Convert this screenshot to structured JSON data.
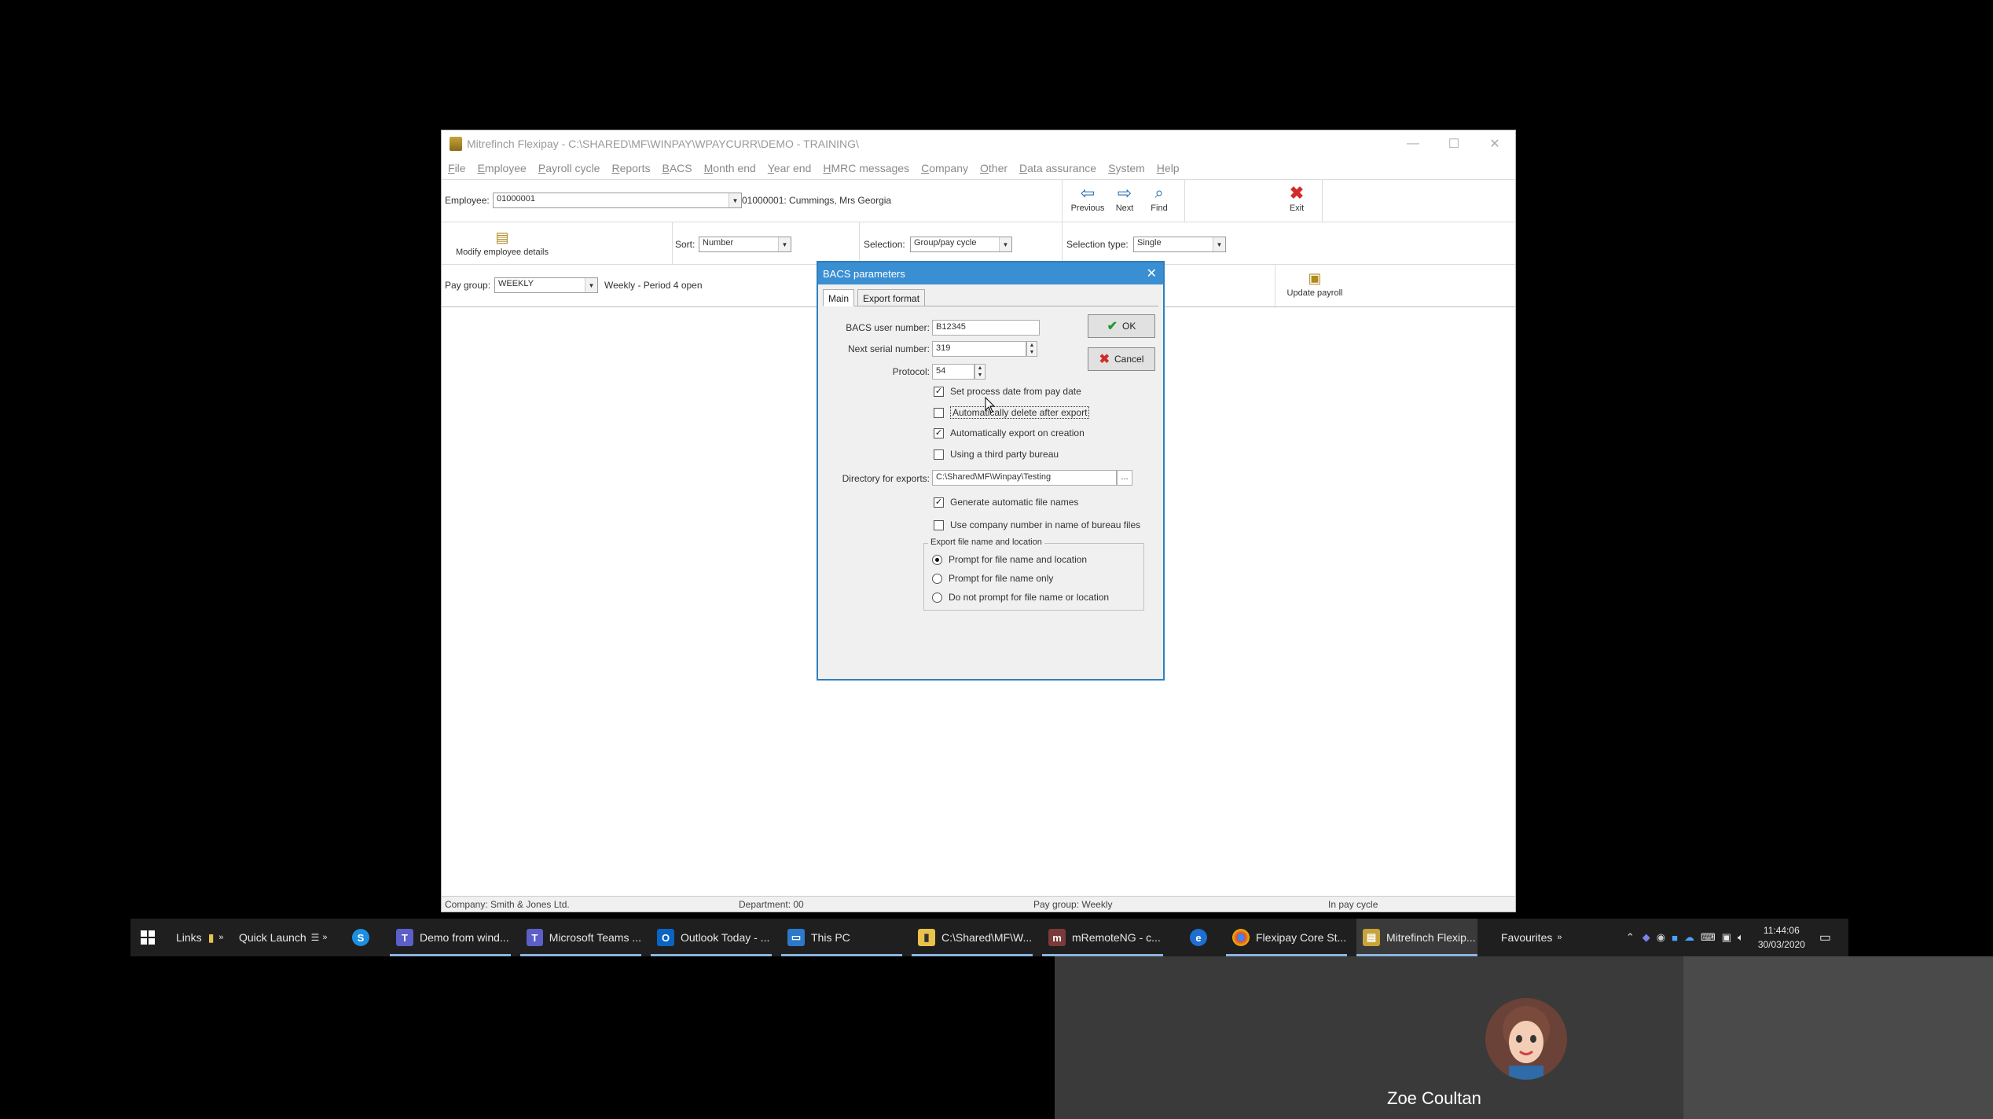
{
  "app": {
    "title": "Mitrefinch Flexipay - C:\\SHARED\\MF\\WINPAY\\WPAYCURR\\DEMO - TRAINING\\",
    "min_icon": "minimize-icon",
    "max_icon": "maximize-icon",
    "close_icon": "close-icon"
  },
  "menu": [
    "File",
    "Employee",
    "Payroll cycle",
    "Reports",
    "BACS",
    "Month end",
    "Year end",
    "HMRC messages",
    "Company",
    "Other",
    "Data assurance",
    "System",
    "Help"
  ],
  "toolbar": {
    "employee_label": "Employee:",
    "employee_value": "01000001",
    "employee_name": "01000001: Cummings, Mrs Georgia",
    "previous": "Previous",
    "next": "Next",
    "find": "Find",
    "exit": "Exit",
    "modify_employee": "Modify employee details",
    "sort_label": "Sort:",
    "sort_value": "Number",
    "selection_label": "Selection:",
    "selection_value": "Group/pay cycle",
    "selection_type_label": "Selection type:",
    "selection_type_value": "Single",
    "pay_group_label": "Pay group:",
    "pay_group_value": "WEEKLY",
    "pay_group_info": "Weekly - Period 4 open",
    "update_payroll": "Update payroll"
  },
  "dialog": {
    "title": "BACS parameters",
    "tabs": [
      "Main",
      "Export format"
    ],
    "bacs_user_number_label": "BACS user number:",
    "bacs_user_number": "B12345",
    "next_serial_label": "Next serial number:",
    "next_serial": "319",
    "protocol_label": "Protocol:",
    "protocol": "54",
    "ok": "OK",
    "cancel": "Cancel",
    "checks": [
      {
        "label": "Set process date from pay date",
        "checked": true
      },
      {
        "label": "Automatically delete after export",
        "checked": false
      },
      {
        "label": "Automatically export on creation",
        "checked": true
      },
      {
        "label": "Using a third party bureau",
        "checked": false
      }
    ],
    "directory_label": "Directory for exports:",
    "directory_value": "C:\\Shared\\MF\\Winpay\\Testing",
    "browse": "...",
    "checks2": [
      {
        "label": "Generate automatic file names",
        "checked": true
      },
      {
        "label": "Use company number in name of bureau files",
        "checked": false
      }
    ],
    "group_title": "Export file name and location",
    "radios": [
      {
        "label": "Prompt for file name and location",
        "selected": true
      },
      {
        "label": "Prompt for file name only",
        "selected": false
      },
      {
        "label": "Do not prompt for file name or location",
        "selected": false
      }
    ]
  },
  "status": {
    "company": "Company: Smith & Jones Ltd.",
    "department": "Department: 00",
    "pay_group": "Pay group: Weekly",
    "state": "In pay cycle"
  },
  "taskbar": {
    "links": "Links",
    "quick_launch": "Quick Launch",
    "items": [
      "Demo from wind...",
      "Microsoft Teams ...",
      "Outlook Today - ...",
      "This PC",
      "C:\\Shared\\MF\\W...",
      "mRemoteNG - c...",
      "Flexipay Core St...",
      "Mitrefinch Flexip..."
    ],
    "favourites": "Favourites",
    "time": "11:44:06",
    "date": "30/03/2020"
  },
  "call": {
    "participant": "Zoe Coultan"
  }
}
